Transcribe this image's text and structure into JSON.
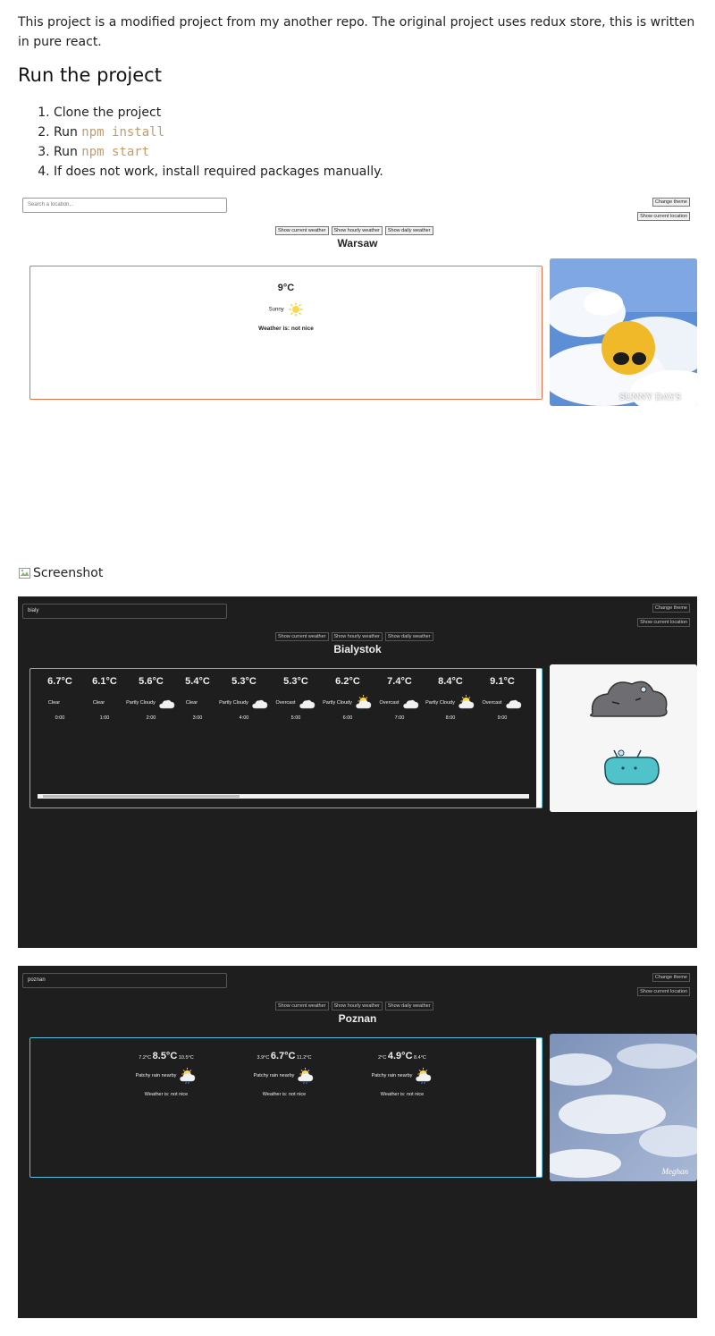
{
  "readme": {
    "intro": "This project is a modified project from my another repo. The original project uses redux store, this is written in pure react.",
    "heading": "Run the project",
    "steps": [
      {
        "pre": "Clone the project",
        "code": ""
      },
      {
        "pre": "Run ",
        "code": "npm install"
      },
      {
        "pre": "Run ",
        "code": "npm start"
      },
      {
        "pre": "If does not work, install required packages manually.",
        "code": ""
      }
    ],
    "broken_image_alt": "Screenshot"
  },
  "controls": {
    "change_theme": "Change theme",
    "show_location": "Show current location",
    "tab_current": "Show current weather",
    "tab_hourly": "Show hourly weather",
    "tab_daily": "Show daily weather"
  },
  "shot1": {
    "search_placeholder": "Search a location...",
    "city": "Warsaw",
    "temp": "9°C",
    "condition": "Sunny",
    "verdict": "Weather is: not nice",
    "gif_caption": "SUNNY DAYS",
    "colors": {
      "card_border": "#e0704a",
      "background": "#ffffff"
    }
  },
  "shot2": {
    "search_value": "bialy",
    "city": "Bialystok",
    "hours": [
      {
        "temp": "6.7°C",
        "cond": "Clear",
        "time": "0:00",
        "icon": "moon-icon"
      },
      {
        "temp": "6.1°C",
        "cond": "Clear",
        "time": "1:00",
        "icon": "moon-icon"
      },
      {
        "temp": "5.6°C",
        "cond": "Partly Cloudy",
        "time": "2:00",
        "icon": "cloud-moon-icon"
      },
      {
        "temp": "5.4°C",
        "cond": "Clear",
        "time": "3:00",
        "icon": "moon-icon"
      },
      {
        "temp": "5.3°C",
        "cond": "Partly Cloudy",
        "time": "4:00",
        "icon": "cloud-moon-icon"
      },
      {
        "temp": "5.3°C",
        "cond": "Overcast",
        "time": "5:00",
        "icon": "cloud-icon"
      },
      {
        "temp": "6.2°C",
        "cond": "Partly Cloudy",
        "time": "6:00",
        "icon": "cloud-sun-icon"
      },
      {
        "temp": "7.4°C",
        "cond": "Overcast",
        "time": "7:00",
        "icon": "cloud-icon"
      },
      {
        "temp": "8.4°C",
        "cond": "Partly Cloudy",
        "time": "8:00",
        "icon": "cloud-sun-icon"
      },
      {
        "temp": "9.1°C",
        "cond": "Overcast",
        "time": "9:00",
        "icon": "cloud-icon"
      }
    ],
    "colors": {
      "card_border": "#5bc0de",
      "background": "#1e1e1e"
    }
  },
  "shot3": {
    "search_value": "poznan",
    "city": "Poznan",
    "days": [
      {
        "min": "7.2°C",
        "avg": "8.5°C",
        "max": "10.5°C",
        "cond": "Patchy rain nearby",
        "verdict": "Weather is: not nice"
      },
      {
        "min": "3.9°C",
        "avg": "6.7°C",
        "max": "11.2°C",
        "cond": "Patchy rain nearby",
        "verdict": "Weather is: not nice"
      },
      {
        "min": "2°C",
        "avg": "4.9°C",
        "max": "8.4°C",
        "cond": "Patchy rain nearby",
        "verdict": "Weather is: not nice"
      }
    ],
    "gif_watermark": "Meghan"
  }
}
